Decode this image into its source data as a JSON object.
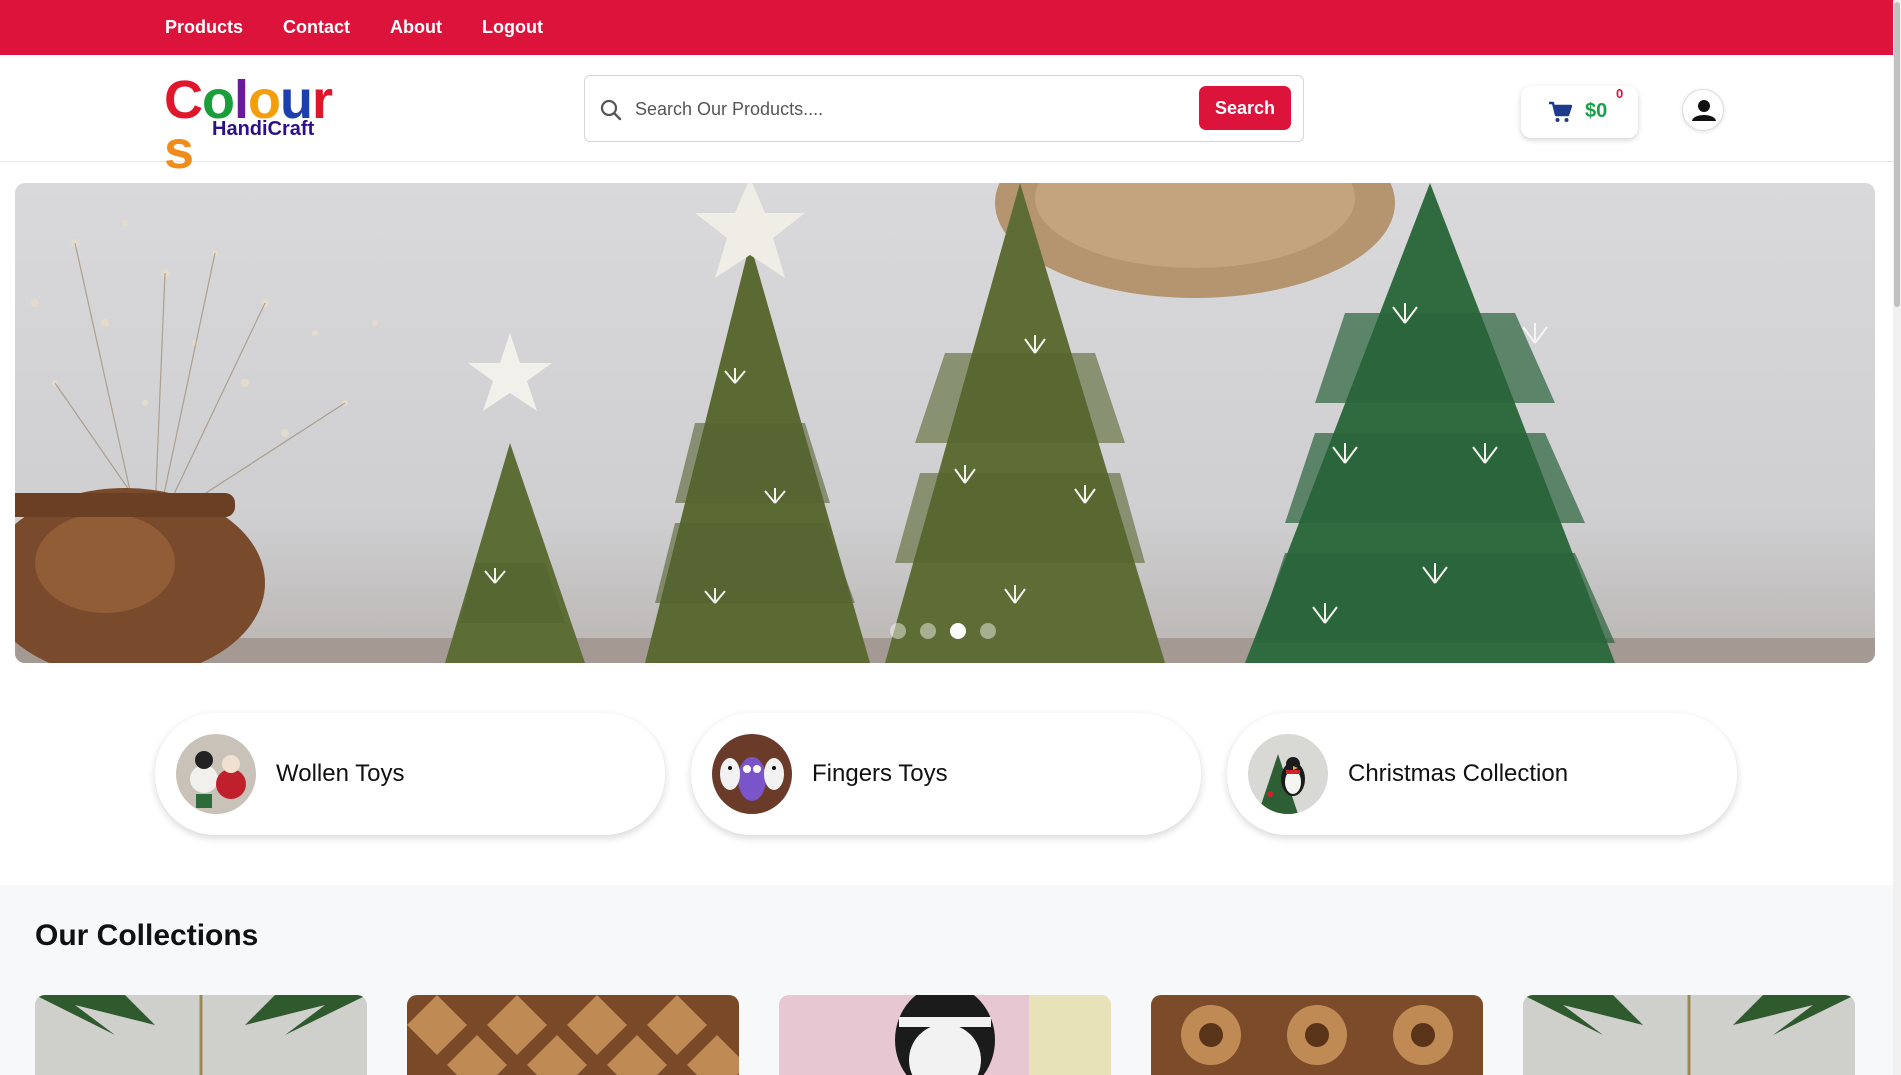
{
  "topnav": {
    "links": [
      "Products",
      "Contact",
      "About",
      "Logout"
    ]
  },
  "brand": {
    "name_letters": [
      "C",
      "o",
      "l",
      "o",
      "u",
      "r",
      "s"
    ],
    "name_colors": [
      "#e0162b",
      "#1a9e3a",
      "#6a1b9a",
      "#f59e0b",
      "#1e40af",
      "#e0162b",
      "#f08c1a"
    ],
    "tagline": "HandiCraft"
  },
  "search": {
    "placeholder": "Search Our Products....",
    "button_label": "Search"
  },
  "cart": {
    "total": "$0",
    "count": "0"
  },
  "hero": {
    "slide_count": 4,
    "active_slide": 3
  },
  "categories": [
    {
      "label": "Wollen Toys"
    },
    {
      "label": "Fingers Toys"
    },
    {
      "label": "Christmas Collection"
    }
  ],
  "collections": {
    "title": "Our Collections"
  },
  "colors": {
    "accent": "#dc143c",
    "price": "#16a34a"
  }
}
